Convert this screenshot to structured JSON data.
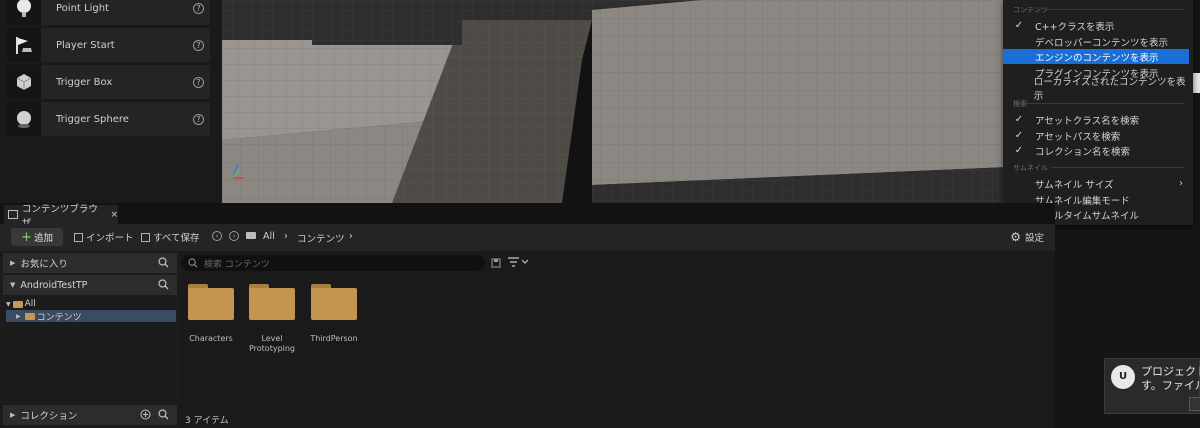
{
  "actors": [
    {
      "label": "Point Light",
      "icon": "bulb-icon"
    },
    {
      "label": "Player Start",
      "icon": "flag-icon"
    },
    {
      "label": "Trigger Box",
      "icon": "cube-icon"
    },
    {
      "label": "Trigger Sphere",
      "icon": "sphere-icon"
    }
  ],
  "menu": {
    "sections": [
      "コンテンツ",
      "検索",
      "サムネイル"
    ],
    "items": [
      {
        "label": "C++クラスを表示",
        "checked": true
      },
      {
        "label": "デベロッパーコンテンツを表示",
        "checked": false
      },
      {
        "label": "エンジンのコンテンツを表示",
        "checked": false,
        "highlighted": true
      },
      {
        "label": "プラグインコンテンツを表示",
        "checked": false
      },
      {
        "label": "ローカライズされたコンテンツを表示",
        "checked": false
      },
      {
        "label": "アセットクラス名を検索",
        "checked": true
      },
      {
        "label": "アセットパスを検索",
        "checked": true
      },
      {
        "label": "コレクション名を検索",
        "checked": true
      },
      {
        "label": "サムネイル サイズ",
        "checked": false,
        "submenu": true
      },
      {
        "label": "サムネイル編集モード",
        "checked": false
      },
      {
        "label": "リアルタイムサムネイル",
        "checked": true
      }
    ],
    "check_glyph": "✓",
    "arrow_glyph": "›"
  },
  "content_browser": {
    "tab_label": "コンテンツブラウザ",
    "tab_close": "×",
    "toolbar": {
      "add_label": "追加",
      "add_glyph": "+",
      "import_label": "インポート",
      "save_all_label": "すべて保存",
      "breadcrumb": [
        "All",
        "コンテンツ"
      ],
      "crumb_sep": "›",
      "settings_label": "設定",
      "settings_glyph": "⚙"
    },
    "sources": {
      "favorites_label": "お気に入り",
      "project_label": "AndroidTestTP",
      "tree": [
        {
          "label": "All",
          "expanded": true
        },
        {
          "label": "コンテンツ",
          "selected": true
        }
      ],
      "collections_label": "コレクション"
    },
    "search_placeholder": "検索 コンテンツ",
    "assets": [
      {
        "name": "Characters"
      },
      {
        "name": "Level\nPrototyping"
      },
      {
        "name": "ThirdPerson"
      }
    ],
    "item_count": "3 アイテム"
  },
  "notification": {
    "line1": "プロジェクト",
    "line2": "す。ファイル"
  },
  "colors": {
    "accent": "#1a6fd6",
    "folder": "#c49451",
    "add_plus": "#8fd36a",
    "selected_row": "#3b4b61"
  }
}
